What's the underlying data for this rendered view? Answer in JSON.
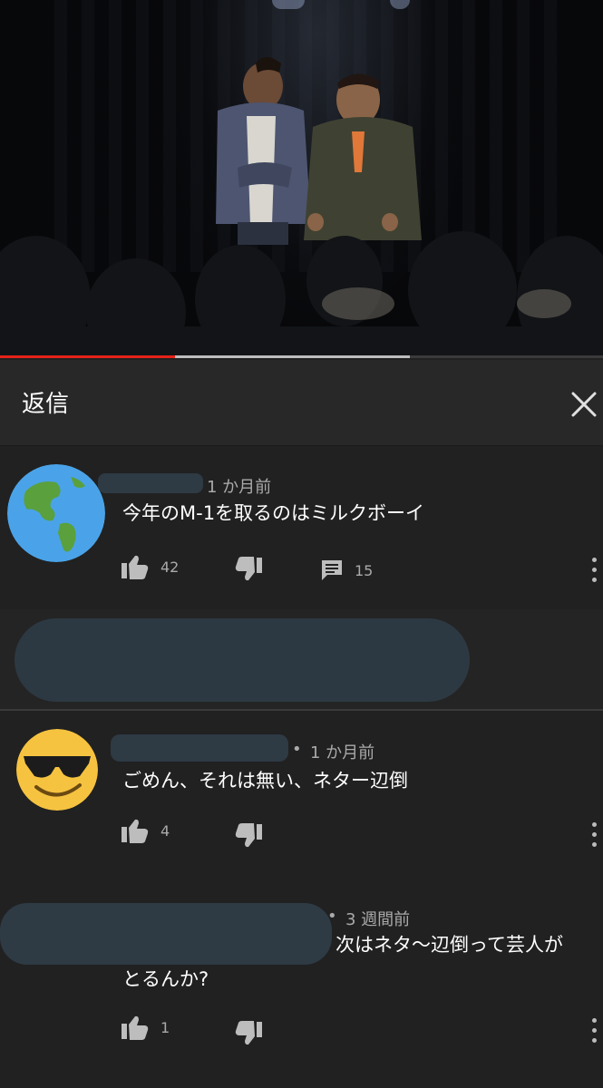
{
  "header": {
    "title": "返信"
  },
  "video": {
    "played_fraction": 0.29,
    "buffered_fraction": 0.68
  },
  "comments": [
    {
      "time": "1 か月前",
      "text": "今年のM-1を取るのはミルクボーイ",
      "likes": "42",
      "replies": "15",
      "avatar_icon": "globe-icon"
    },
    {
      "time": "1 か月前",
      "text": "ごめん、それは無い、ネター辺倒",
      "likes": "4",
      "avatar_icon": "sunglasses-face-icon"
    },
    {
      "time": "3 週間前",
      "text_line1": "次はネタ〜辺倒って芸人が",
      "text_line2": "とるんか?",
      "likes": "1"
    }
  ],
  "colors": {
    "background": "#212121",
    "progress": "#e62117",
    "muted_text": "#aaaaaa",
    "redaction": "#2e3a44"
  }
}
